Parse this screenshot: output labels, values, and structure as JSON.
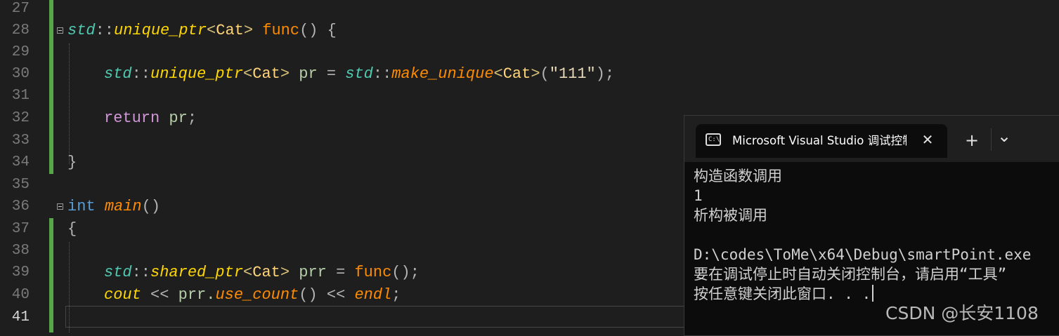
{
  "editor": {
    "line_numbers": [
      "27",
      "28",
      "29",
      "30",
      "31",
      "32",
      "33",
      "34",
      "35",
      "36",
      "37",
      "38",
      "39",
      "40",
      "41"
    ],
    "lines": {
      "l28": {
        "ns": "std",
        "sep": "::",
        "type": "unique_ptr",
        "lt": "<",
        "cls": "Cat",
        "gt": ">",
        "sp": " ",
        "fn": "func",
        "rest": "() {"
      },
      "l30": {
        "ns": "std",
        "sep": "::",
        "type": "unique_ptr",
        "lt": "<",
        "cls": "Cat",
        "gt": ">",
        "var": " pr",
        "eq": " = ",
        "ns2": "std",
        "sep2": "::",
        "fn": "make_unique",
        "lt2": "<",
        "cls2": "Cat",
        "gt2": ">",
        "open": "(",
        "str": "\"111\"",
        "close": ");"
      },
      "l32": {
        "kw": "return",
        "var": " pr",
        "semi": ";"
      },
      "l34": {
        "brace": "}"
      },
      "l36": {
        "kw": "int",
        "sp": " ",
        "fn": "main",
        "rest": "()"
      },
      "l37": {
        "brace": "{"
      },
      "l39": {
        "ns": "std",
        "sep": "::",
        "type": "shared_ptr",
        "lt": "<",
        "cls": "Cat",
        "gt": ">",
        "var": " prr",
        "eq": " = ",
        "fn": "func",
        "rest": "();"
      },
      "l40": {
        "obj": "cout",
        "op1": " << ",
        "var": "prr.",
        "fn": "use_count",
        "paren": "()",
        "op2": " << ",
        "fn2": "endl",
        "semi": ";"
      }
    }
  },
  "console": {
    "tab_title": "Microsoft Visual Studio 调试控制台",
    "tab_icon_text": "C:\\",
    "close_symbol": "✕",
    "new_tab_symbol": "+",
    "dropdown_symbol": "⌄",
    "output": [
      "构造函数调用",
      "1",
      "析构被调用",
      "",
      "D:\\codes\\ToMe\\x64\\Debug\\smartPoint.exe",
      "要在调试停止时自动关闭控制台，请启用“工具”",
      "按任意键关闭此窗口. . ."
    ]
  },
  "watermark": "CSDN @长安1108"
}
